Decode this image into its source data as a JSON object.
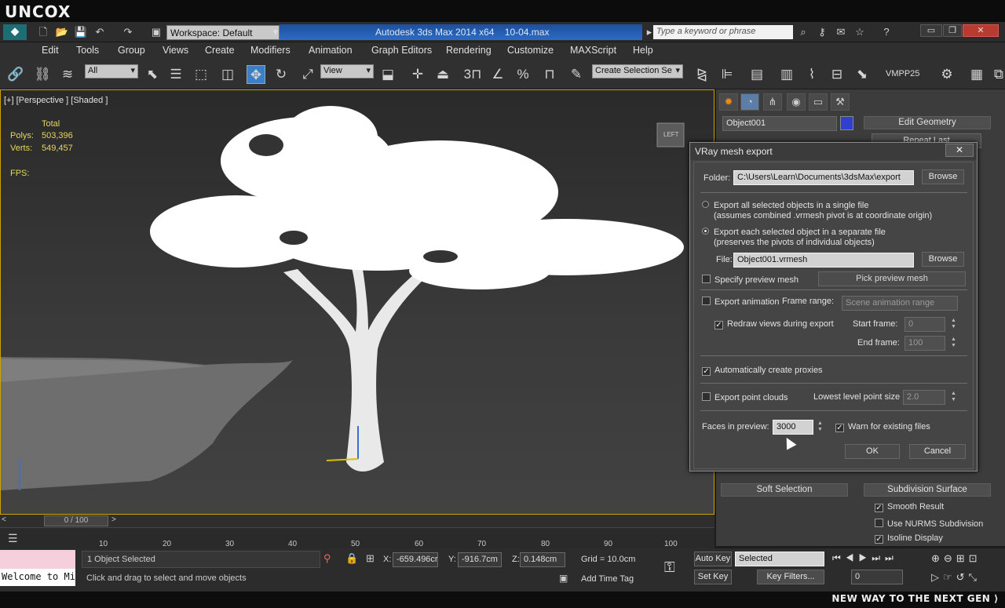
{
  "brand": "UNCOX",
  "titlebar": {
    "workspace": "Workspace: Default",
    "app_title": "Autodesk 3ds Max  2014 x64",
    "file_name": "10-04.max",
    "search_placeholder": "Type a keyword or phrase"
  },
  "menu": [
    "Edit",
    "Tools",
    "Group",
    "Views",
    "Create",
    "Modifiers",
    "Animation",
    "Graph Editors",
    "Rendering",
    "Customize",
    "MAXScript",
    "Help"
  ],
  "toolbar": {
    "selection_filter": "All",
    "reference_coord": "View",
    "named_selection": "Create Selection Se",
    "vmpp_label": "VMPP25"
  },
  "viewport": {
    "label": "[+] [Perspective ] [Shaded ]",
    "stats_header": "Total",
    "polys_label": "Polys:",
    "polys_value": "503,396",
    "verts_label": "Verts:",
    "verts_value": "549,457",
    "fps_label": "FPS:",
    "viewcube": "LEFT"
  },
  "command_panel": {
    "object_name": "Object001",
    "object_color": "#2f3fd0",
    "edit_geometry": "Edit Geometry",
    "repeat_last": "Repeat Last",
    "soft_selection": "Soft Selection",
    "subdivision_surface": "Subdivision Surface",
    "smooth_result": "Smooth Result",
    "use_nurms": "Use NURMS Subdivision",
    "isoline_display": "Isoline Display"
  },
  "dialog": {
    "title": "VRay mesh export",
    "folder_label": "Folder:",
    "folder_value": "C:\\Users\\Learn\\Documents\\3dsMax\\export",
    "browse": "Browse",
    "opt_single": "Export all selected objects in a single file",
    "opt_single_note": "(assumes combined .vrmesh pivot is at coordinate origin)",
    "opt_separate": "Export each selected object in a separate file",
    "opt_separate_note": "(preserves the pivots of individual objects)",
    "file_label": "File:",
    "file_value": "Object001.vrmesh",
    "specify_preview": "Specify preview mesh",
    "pick_preview": "Pick preview mesh",
    "export_animation": "Export animation",
    "frame_range_label": "Frame range:",
    "frame_range_value": "Scene animation range",
    "redraw_views": "Redraw views during export",
    "start_frame_label": "Start frame:",
    "start_frame_value": "0",
    "end_frame_label": "End frame:",
    "end_frame_value": "100",
    "auto_proxies": "Automatically create proxies",
    "export_point_clouds": "Export point clouds",
    "lowest_level_label": "Lowest level point size",
    "lowest_level_value": "2.0",
    "faces_label": "Faces in preview:",
    "faces_value": "3000",
    "warn_existing": "Warn for existing files",
    "ok": "OK",
    "cancel": "Cancel"
  },
  "timeline": {
    "frame_counter": "0 / 100",
    "ticks": [
      "10",
      "20",
      "30",
      "40",
      "50",
      "60",
      "70",
      "80",
      "90",
      "100"
    ]
  },
  "status": {
    "maxscript_text": "Welcome to Mi",
    "selection_info": "1 Object Selected",
    "prompt": "Click and drag to select and move objects",
    "x_label": "X:",
    "x_value": "-659.496cr",
    "y_label": "Y:",
    "y_value": "-916.7cm",
    "z_label": "Z:",
    "z_value": "0.148cm",
    "grid": "Grid = 10.0cm",
    "add_time_tag": "Add Time Tag",
    "auto_key": "Auto Key",
    "set_key": "Set Key",
    "key_mode": "Selected",
    "key_filters": "Key Filters...",
    "current_frame": "0"
  },
  "slogan": "NEW WAY TO THE NEXT GEN ⟩"
}
